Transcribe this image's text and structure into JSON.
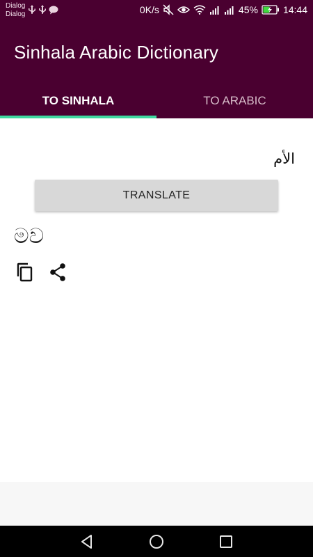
{
  "status_bar": {
    "carriers": [
      "Dialog",
      "Dialog"
    ],
    "speed": "0K/s",
    "battery_percent": "45%",
    "time": "14:44",
    "icons_left": [
      "usb-icon",
      "usb-icon",
      "chat-icon"
    ],
    "icons_right": [
      "mute-icon",
      "eye-icon",
      "wifi-icon",
      "signal-icon",
      "signal-icon",
      "battery-icon"
    ]
  },
  "app_bar": {
    "title": "Sinhala Arabic Dictionary",
    "background": "#4a0030"
  },
  "tabs": [
    {
      "label": "TO SINHALA",
      "active": true
    },
    {
      "label": "TO ARABIC",
      "active": false
    }
  ],
  "accent_color": "#3fd9a0",
  "main": {
    "input_text": "الأم",
    "translate_label": "TRANSLATE",
    "result_text": "මව",
    "actions": [
      "copy-icon",
      "share-icon"
    ]
  },
  "nav": {
    "buttons": [
      "back-icon",
      "home-icon",
      "recents-icon"
    ]
  }
}
